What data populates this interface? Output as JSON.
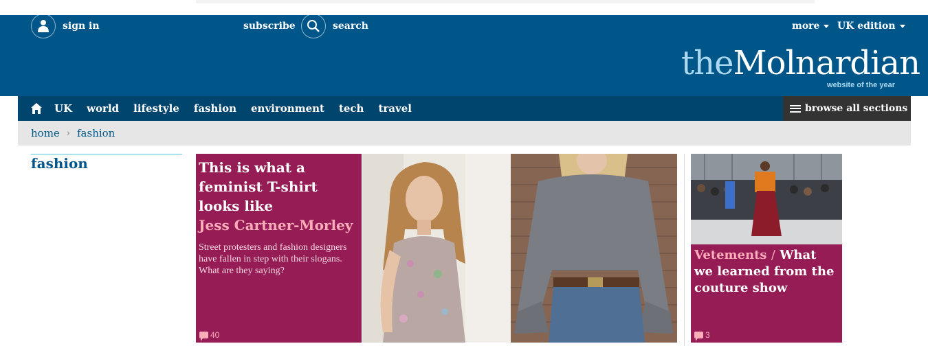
{
  "header": {
    "signin_label": "sign in",
    "subscribe_label": "subscribe",
    "search_label": "search",
    "more_label": "more",
    "edition_label": "UK edition"
  },
  "logo": {
    "prefix": "the",
    "name": "Molnardian",
    "tagline": "website of the year"
  },
  "nav": {
    "items": [
      "UK",
      "world",
      "lifestyle",
      "fashion",
      "environment",
      "tech",
      "travel"
    ],
    "browse_label": "browse all sections"
  },
  "breadcrumb": {
    "home": "home",
    "separator": "›",
    "current": "fashion"
  },
  "section": {
    "title": "fashion"
  },
  "feature": {
    "headline": "This is what a feminist T-shirt looks like",
    "byline": "Jess Cartner-Morley",
    "standfirst": "Street protesters and fashion designers have fallen in step with their slogans. What are they saying?",
    "comment_count": "40"
  },
  "card": {
    "kicker": "Vetements",
    "separator": "/",
    "headline": "What we learned from the couture show",
    "comment_count": "3"
  },
  "colors": {
    "masthead": "#005689",
    "nav": "#00456e",
    "fashion_pink": "#951c55",
    "kicker_pink": "#fdadba",
    "breadcrumb_bg": "#e6e6e6"
  },
  "icons": {
    "signin": "user-icon",
    "search": "search-icon",
    "home": "home-icon",
    "browse": "menu-icon",
    "comments": "comment-icon"
  }
}
